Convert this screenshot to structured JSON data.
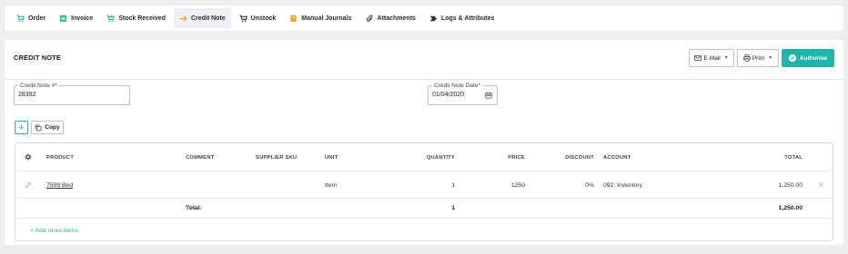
{
  "tabs": [
    {
      "label": "Order",
      "icon": "cart-icon"
    },
    {
      "label": "Invoice",
      "icon": "invoice-icon"
    },
    {
      "label": "Stock Received",
      "icon": "cart-received-icon"
    },
    {
      "label": "Credit Note",
      "icon": "arrow-right-icon"
    },
    {
      "label": "Unstock",
      "icon": "cart-unstock-icon"
    },
    {
      "label": "Manual Journals",
      "icon": "journal-icon"
    },
    {
      "label": "Attachments",
      "icon": "paperclip-icon"
    },
    {
      "label": "Logs & Attributes",
      "icon": "tag-icon"
    }
  ],
  "active_tab": "Credit Note",
  "header": {
    "title": "CREDIT NOTE",
    "email_label": "E-Mail",
    "print_label": "Print",
    "authorise_label": "Authorise"
  },
  "form": {
    "credit_note_label": "Credit Note #*",
    "credit_note_value": "28392",
    "date_label": "Credit Note Date*",
    "date_value": "01/04/2020"
  },
  "toolbar": {
    "add_label": "+",
    "copy_label": "Copy"
  },
  "table": {
    "columns": {
      "product": "PRODUCT",
      "comment": "COMMENT",
      "supplier_sku": "SUPPLIER SKU",
      "unit": "UNIT",
      "quantity": "QUANTITY",
      "price": "PRICE",
      "discount": "DISCOUNT",
      "account": "ACCOUNT",
      "total": "TOTAL"
    },
    "rows": [
      {
        "product": "7599:Bed",
        "comment": "",
        "supplier_sku": "",
        "unit": "Item",
        "quantity": "1",
        "price": "1250",
        "discount": "0%",
        "account": "092: Inventory",
        "total": "1,250.00"
      }
    ],
    "totals": {
      "label": "Total:",
      "quantity": "1",
      "total": "1,250.00"
    },
    "add_more_label": "+ Add more items"
  },
  "colors": {
    "accent": "#1fb5a8",
    "tab_icon": "#1fb5a8",
    "journal_icon": "#f0a020"
  }
}
